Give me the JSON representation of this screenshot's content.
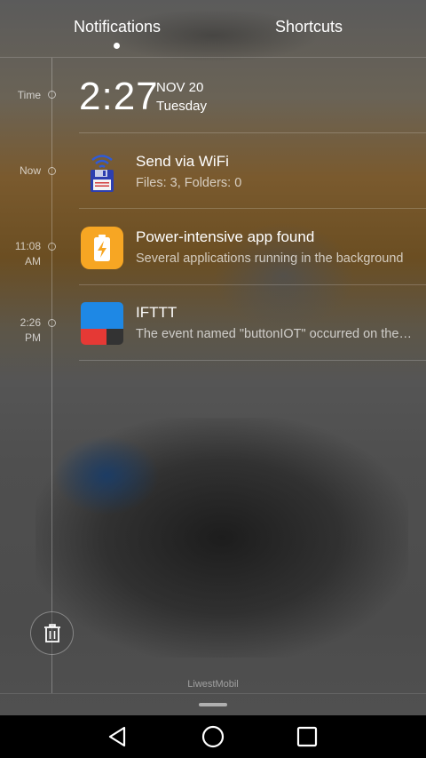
{
  "tabs": {
    "notifications": "Notifications",
    "shortcuts": "Shortcuts",
    "active": "notifications"
  },
  "header": {
    "time_label": "Time",
    "clock": "2:27",
    "date": "NOV 20",
    "day": "Tuesday"
  },
  "notifications": [
    {
      "time_line1": "Now",
      "time_line2": "",
      "icon": "floppy-wifi-icon",
      "title": "Send via WiFi",
      "subtitle": "Files: 3, Folders: 0"
    },
    {
      "time_line1": "11:08",
      "time_line2": "AM",
      "icon": "battery-bolt-icon",
      "title": "Power-intensive app found",
      "subtitle": "Several applications running in the background"
    },
    {
      "time_line1": "2:26",
      "time_line2": "PM",
      "icon": "ifttt-icon",
      "title": "IFTTT",
      "subtitle": "The event named \"buttonIOT\" occurred on the Maker service"
    }
  ],
  "footer": {
    "carrier": "LiwestMobil",
    "clear_icon": "trash-icon"
  },
  "navbar": {
    "back_icon": "back-triangle-icon",
    "home_icon": "home-circle-icon",
    "recents_icon": "recents-square-icon"
  },
  "colors": {
    "battery_icon_bg": "#f7a623",
    "ifttt_blue": "#1e88e5",
    "ifttt_red": "#e53935"
  }
}
